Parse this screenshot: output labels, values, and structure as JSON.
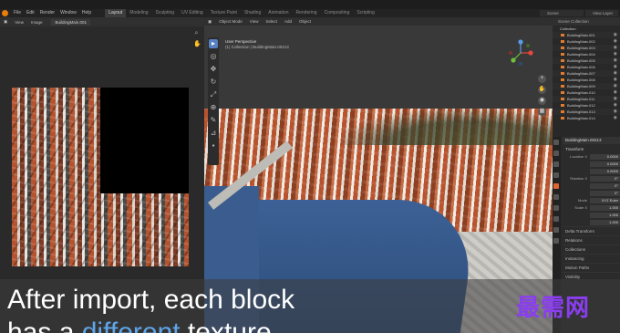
{
  "topbar": {
    "menus": [
      "File",
      "Edit",
      "Render",
      "Window",
      "Help"
    ],
    "workspace_tabs": [
      "Layout",
      "Modeling",
      "Sculpting",
      "UV Editing",
      "Texture Paint",
      "Shading",
      "Animation",
      "Rendering",
      "Compositing",
      "Scripting"
    ],
    "active_tab_index": 0,
    "scene": "Scene",
    "view_layer": "View Layer"
  },
  "image_editor": {
    "header_items": [
      "View",
      "Image"
    ],
    "image_name": "BuildingMain.001"
  },
  "viewport": {
    "header_items": [
      "Object Mode",
      "View",
      "Select",
      "Add",
      "Object"
    ],
    "view_label": "User Perspective",
    "collection_label": "(1) Collection | BuildingMain.00213"
  },
  "outliner": {
    "title": "Scene Collection",
    "collection": "Collection",
    "items": [
      "BuildingMain.001",
      "BuildingMain.002",
      "BuildingMain.003",
      "BuildingMain.004",
      "BuildingMain.005",
      "BuildingMain.006",
      "BuildingMain.007",
      "BuildingMain.008",
      "BuildingMain.009",
      "BuildingMain.010",
      "BuildingMain.011",
      "BuildingMain.012",
      "BuildingMain.013",
      "BuildingMain.014"
    ]
  },
  "properties": {
    "object_name": "BuildingMain.00213",
    "panel_title": "BuildingMain.00213",
    "transform_label": "Transform",
    "location_label": "Location X",
    "location_values": [
      "0.0000",
      "0.0000",
      "0.0000"
    ],
    "rotation_label": "Rotation X",
    "rotation_values": [
      "0°",
      "0°",
      "0°"
    ],
    "mode_label": "Mode",
    "mode_value": "XYZ Euler",
    "scale_label": "Scale X",
    "scale_values": [
      "1.000",
      "1.000",
      "1.000"
    ],
    "collapsed_sections": [
      "Delta Transform",
      "Relations",
      "Collections",
      "Instancing",
      "Motion Paths",
      "Visibility"
    ]
  },
  "caption": {
    "line1": "After import, each block",
    "line2_before": "has a ",
    "line2_highlight": "different",
    "line2_after": " texture"
  },
  "watermark": "最需网"
}
